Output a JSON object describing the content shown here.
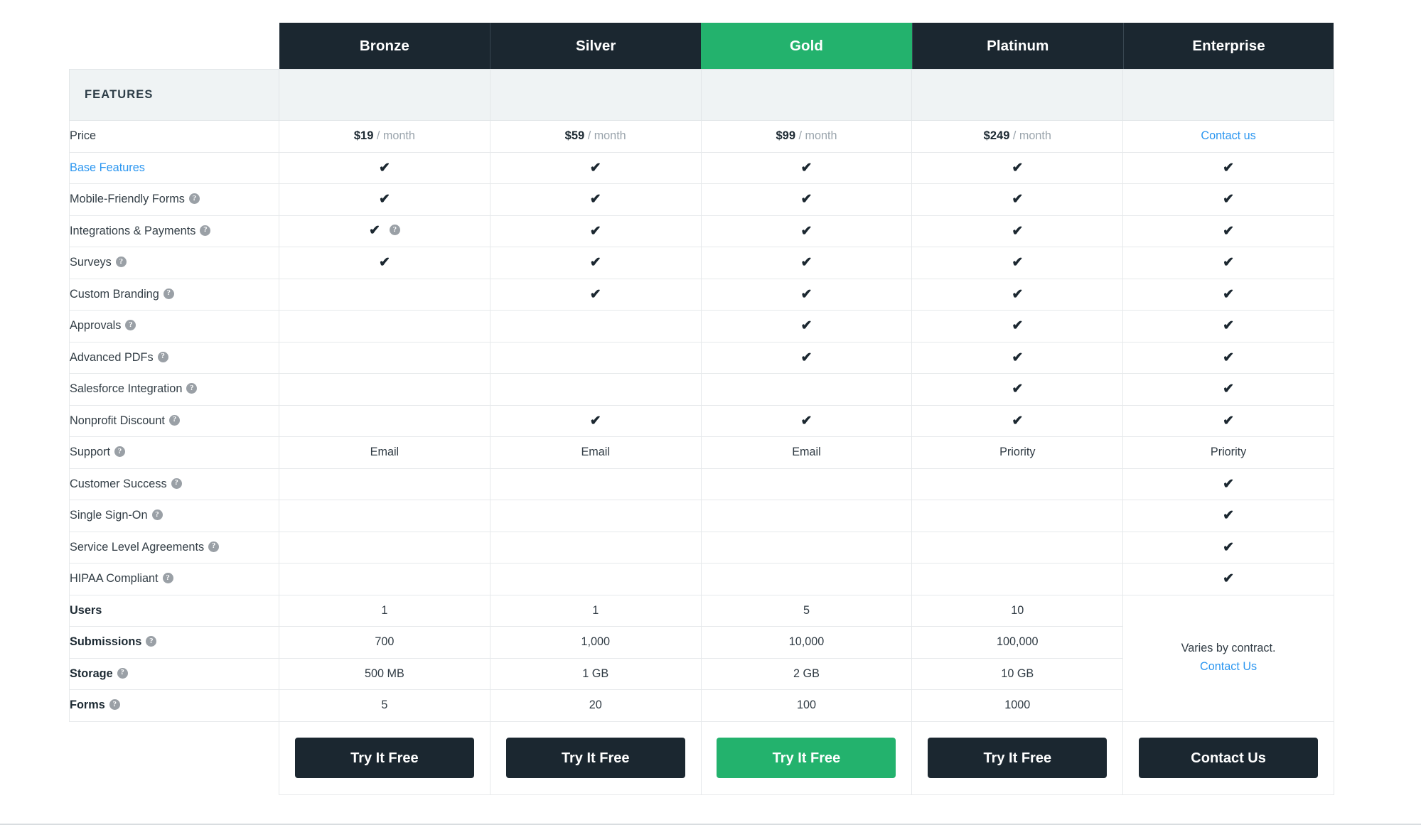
{
  "table": {
    "features_header": "FEATURES",
    "plans": [
      {
        "name": "Bronze",
        "highlight": false,
        "price_amount": "$19",
        "price_period": "/ month",
        "cta": "Try It Free"
      },
      {
        "name": "Silver",
        "highlight": false,
        "price_amount": "$59",
        "price_period": "/ month",
        "cta": "Try It Free"
      },
      {
        "name": "Gold",
        "highlight": true,
        "price_amount": "$99",
        "price_period": "/ month",
        "cta": "Try It Free"
      },
      {
        "name": "Platinum",
        "highlight": false,
        "price_amount": "$249",
        "price_period": "/ month",
        "cta": "Try It Free"
      },
      {
        "name": "Enterprise",
        "highlight": false,
        "price_amount": "Contact us",
        "price_period": "",
        "cta": "Contact Us"
      }
    ],
    "price_row_label": "Price",
    "rows": [
      {
        "label": "Base Features",
        "help": false,
        "link": true,
        "bold": false,
        "cells": [
          "check",
          "check",
          "check",
          "check",
          "check"
        ]
      },
      {
        "label": "Mobile-Friendly Forms",
        "help": true,
        "link": false,
        "bold": false,
        "cells": [
          "check",
          "check",
          "check",
          "check",
          "check"
        ]
      },
      {
        "label": "Integrations & Payments",
        "help": true,
        "link": false,
        "bold": false,
        "cells": [
          "check-help",
          "check",
          "check",
          "check",
          "check"
        ]
      },
      {
        "label": "Surveys",
        "help": true,
        "link": false,
        "bold": false,
        "cells": [
          "check",
          "check",
          "check",
          "check",
          "check"
        ]
      },
      {
        "label": "Custom Branding",
        "help": true,
        "link": false,
        "bold": false,
        "cells": [
          "",
          "check",
          "check",
          "check",
          "check"
        ]
      },
      {
        "label": "Approvals",
        "help": true,
        "link": false,
        "bold": false,
        "cells": [
          "",
          "",
          "check",
          "check",
          "check"
        ]
      },
      {
        "label": "Advanced PDFs",
        "help": true,
        "link": false,
        "bold": false,
        "cells": [
          "",
          "",
          "check",
          "check",
          "check"
        ]
      },
      {
        "label": "Salesforce Integration",
        "help": true,
        "link": false,
        "bold": false,
        "cells": [
          "",
          "",
          "",
          "check",
          "check"
        ]
      },
      {
        "label": "Nonprofit Discount",
        "help": true,
        "link": false,
        "bold": false,
        "cells": [
          "",
          "check",
          "check",
          "check",
          "check"
        ]
      },
      {
        "label": "Support",
        "help": true,
        "link": false,
        "bold": false,
        "cells": [
          "Email",
          "Email",
          "Email",
          "Priority",
          "Priority"
        ]
      },
      {
        "label": "Customer Success",
        "help": true,
        "link": false,
        "bold": false,
        "cells": [
          "",
          "",
          "",
          "",
          "check"
        ]
      },
      {
        "label": "Single Sign-On",
        "help": true,
        "link": false,
        "bold": false,
        "cells": [
          "",
          "",
          "",
          "",
          "check"
        ]
      },
      {
        "label": "Service Level Agreements",
        "help": true,
        "link": false,
        "bold": false,
        "cells": [
          "",
          "",
          "",
          "",
          "check"
        ]
      },
      {
        "label": "HIPAA Compliant",
        "help": true,
        "link": false,
        "bold": false,
        "cells": [
          "",
          "",
          "",
          "",
          "check"
        ]
      },
      {
        "label": "Users",
        "help": false,
        "link": false,
        "bold": true,
        "cells": [
          "1",
          "1",
          "5",
          "10",
          "MERGED"
        ]
      },
      {
        "label": "Submissions",
        "help": true,
        "link": false,
        "bold": true,
        "cells": [
          "700",
          "1,000",
          "10,000",
          "100,000",
          "MERGED"
        ]
      },
      {
        "label": "Storage",
        "help": true,
        "link": false,
        "bold": true,
        "cells": [
          "500 MB",
          "1 GB",
          "2 GB",
          "10 GB",
          "MERGED"
        ]
      },
      {
        "label": "Forms",
        "help": true,
        "link": false,
        "bold": true,
        "cells": [
          "5",
          "20",
          "100",
          "1000",
          "MERGED"
        ]
      }
    ],
    "enterprise_merged": {
      "text": "Varies by contract.",
      "link": "Contact Us"
    },
    "help_icon_glyph": "?",
    "check_glyph": "✔"
  },
  "colors": {
    "header_dark": "#1b2730",
    "highlight_green": "#23b26d",
    "link_blue": "#2b96f0",
    "band_gray": "#eff3f4",
    "border": "#e6e9eb",
    "text_dark": "#333e46",
    "muted": "#9aa4ac"
  }
}
